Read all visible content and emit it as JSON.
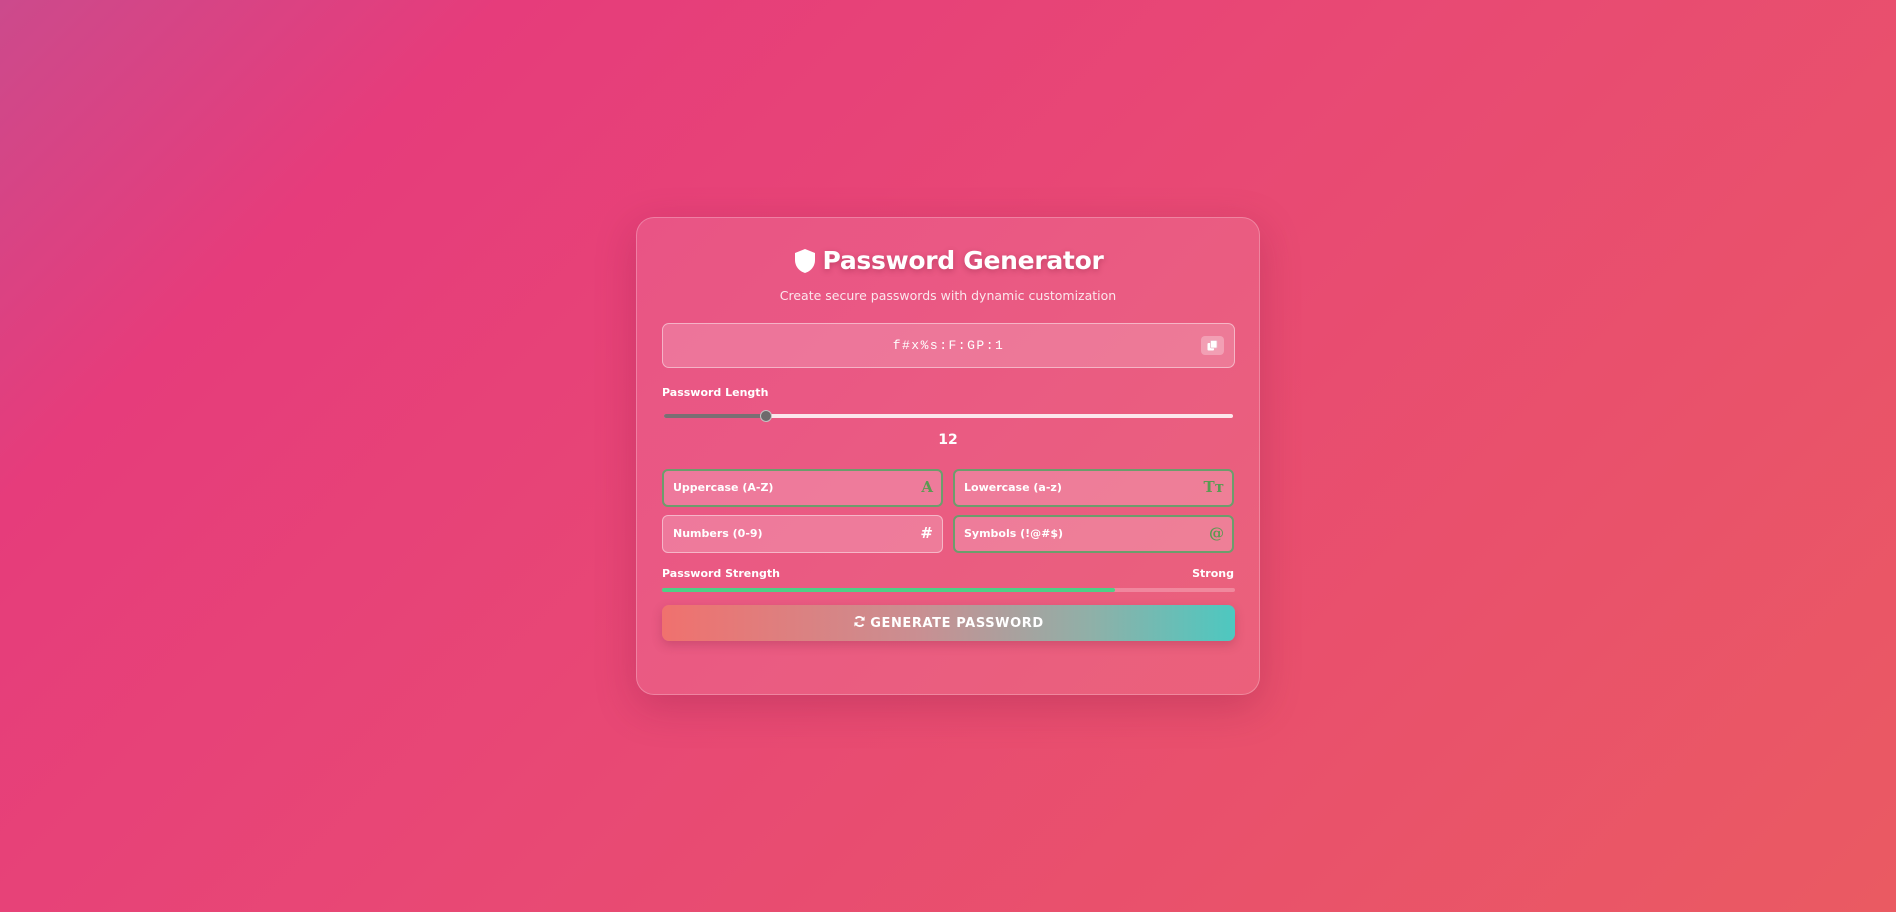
{
  "app": {
    "title": "Password Generator",
    "subtitle": "Create secure passwords with dynamic customization",
    "title_icon": "shield-icon"
  },
  "password": {
    "value": "f#x%s:F:GP:1",
    "copy_icon": "copy-icon"
  },
  "length": {
    "label": "Password Length",
    "value": "12",
    "fraction": 0.18
  },
  "options": [
    {
      "label": "Uppercase (A-Z)",
      "icon": "A",
      "icon_name": "uppercase-icon",
      "checked": true
    },
    {
      "label": "Lowercase (a-z)",
      "icon": "Tт",
      "icon_name": "text-case-icon",
      "checked": true
    },
    {
      "label": "Numbers (0-9)",
      "icon": "#",
      "icon_name": "hash-icon",
      "checked": false
    },
    {
      "label": "Symbols (!@#$)",
      "icon": "@",
      "icon_name": "at-icon",
      "checked": true
    }
  ],
  "strength": {
    "label": "Password Strength",
    "value": "Strong",
    "fraction": 0.79,
    "color": "#4fcf86"
  },
  "generate_button": {
    "label": "GENERATE PASSWORD",
    "icon": "refresh-icon"
  },
  "colors": {
    "checked_border": "#6c9d6c",
    "button_gradient_start": "#f0716e",
    "button_gradient_end": "#4dc8c0"
  }
}
